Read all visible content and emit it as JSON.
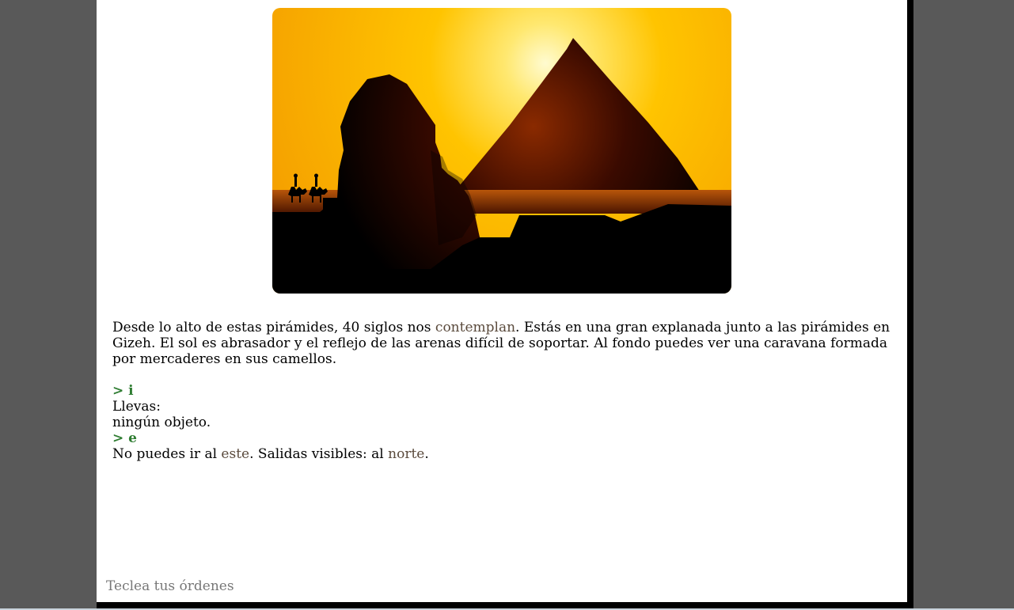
{
  "scene": {
    "image_description_icon": "pyramids-sphinx-sunset-image"
  },
  "narrative": {
    "intro_before": "Desde lo alto de estas pirámides, 40 siglos nos ",
    "intro_link": "contemplan",
    "intro_after": ". Estás en una gran explanada junto a las pirámides en Gizeh. El sol es abrasador y el reflejo de las arenas difícil de soportar. Al fondo puedes ver una caravana formada por mercaderes en sus camellos.",
    "command_1": "> i",
    "response_1_line1": "Llevas:",
    "response_1_line2": "ningún objeto.",
    "command_2": "> e",
    "response_2_before": "No puedes ir al ",
    "response_2_link1": "este",
    "response_2_mid": ". Salidas visibles: al ",
    "response_2_link2": "norte",
    "response_2_after": "."
  },
  "input": {
    "placeholder": "Teclea tus órdenes"
  },
  "colors": {
    "command": "#2f7d32",
    "link": "#5a4a3c",
    "background": "#595959"
  }
}
